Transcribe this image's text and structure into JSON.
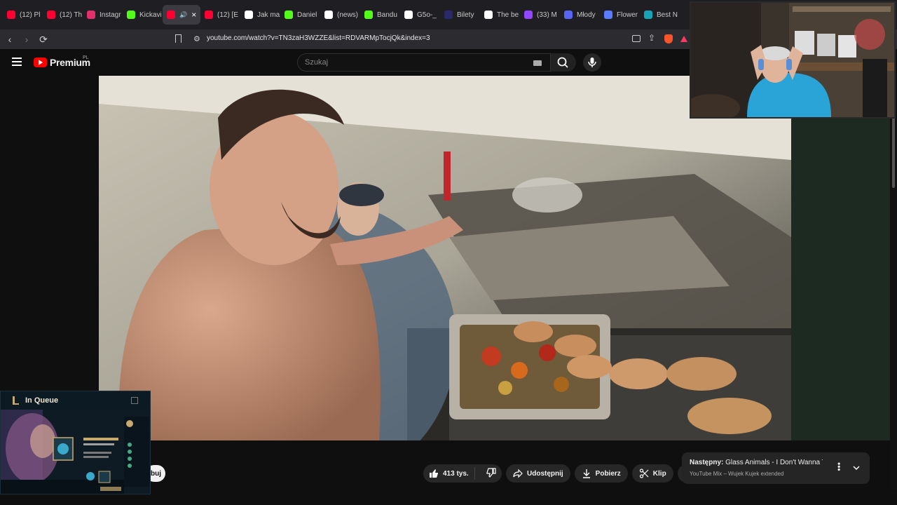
{
  "browser": {
    "tabs": [
      {
        "label": "(12) Pl",
        "color": "#ff0033"
      },
      {
        "label": "(12) Th",
        "color": "#ff0033"
      },
      {
        "label": "Instagr",
        "color": "#e1306c"
      },
      {
        "label": "Kickavi",
        "color": "#53fc18"
      },
      {
        "label": "",
        "color": "#ff0033",
        "active": true
      },
      {
        "label": "(12) [E",
        "color": "#ff0033"
      },
      {
        "label": "Jak ma",
        "color": "#ffffff"
      },
      {
        "label": "Daniel",
        "color": "#53fc18"
      },
      {
        "label": "(news)",
        "color": "#ffffff"
      },
      {
        "label": "Bandu",
        "color": "#53fc18"
      },
      {
        "label": "G5o-_",
        "color": "#ffffff"
      },
      {
        "label": "Bilety",
        "color": "#2a2a6b"
      },
      {
        "label": "The be",
        "color": "#ffffff"
      },
      {
        "label": "(33) M",
        "color": "#9146ff"
      },
      {
        "label": "Młody",
        "color": "#5865f2"
      },
      {
        "label": "Flower",
        "color": "#5b7bff"
      },
      {
        "label": "Best N",
        "color": "#17a2b8"
      }
    ],
    "url": "youtube.com/watch?v=TN3zaH3WZZE&list=RDVARMpTocjQk&index=3"
  },
  "youtube": {
    "logo_text": "Premium",
    "logo_region": "PL",
    "search_placeholder": "Szukaj"
  },
  "actions": {
    "likes": "413 tys.",
    "share": "Udostępnij",
    "download": "Pobierz",
    "clip": "Klip",
    "subscribe_fragment": "buj"
  },
  "up_next": {
    "prefix": "Następny:",
    "title": "Glass Animals - I Don't Wanna Tal...",
    "subtitle": "YouTube Mix – Wujek Kujek extended"
  },
  "overlay": {
    "queue_title": "In Queue"
  }
}
